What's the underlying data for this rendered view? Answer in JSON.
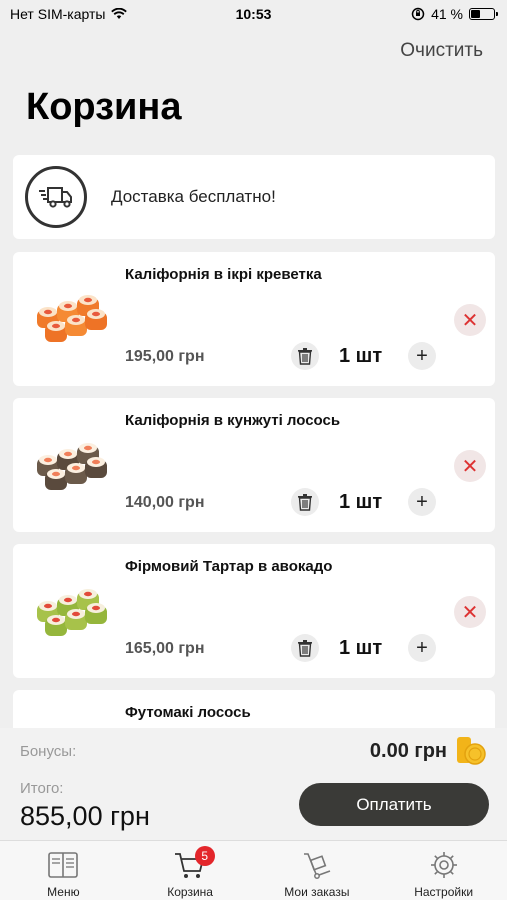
{
  "status_bar": {
    "carrier": "Нет SIM-карты",
    "time": "10:53",
    "battery_percent": "41 %"
  },
  "header": {
    "clear_label": "Очистить",
    "title": "Корзина"
  },
  "delivery": {
    "icon": "delivery-truck-icon",
    "text": "Доставка бесплатно!"
  },
  "cart_items": [
    {
      "name": "Каліфорнія в ікрі креветка",
      "price": "195,00 грн",
      "quantity": "1 шт",
      "image": "sushi-roll-orange"
    },
    {
      "name": "Каліфорнія в кунжуті лосось",
      "price": "140,00 грн",
      "quantity": "1 шт",
      "image": "sushi-roll-sesame"
    },
    {
      "name": "Фірмовий Тартар в авокадо",
      "price": "165,00 грн",
      "quantity": "1 шт",
      "image": "sushi-roll-avocado"
    },
    {
      "name": "Футомакі лосось"
    }
  ],
  "summary": {
    "bonus_label": "Бонусы:",
    "bonus_value": "0.00 грн",
    "total_label": "Итого:",
    "total_value": "855,00 грн",
    "pay_label": "Оплатить"
  },
  "tabbar": {
    "tabs": [
      {
        "label": "Меню",
        "icon": "menu-book-icon"
      },
      {
        "label": "Корзина",
        "icon": "cart-icon",
        "badge": "5"
      },
      {
        "label": "Мои заказы",
        "icon": "orders-cart-icon"
      },
      {
        "label": "Настройки",
        "icon": "gear-icon"
      }
    ]
  },
  "colors": {
    "background": "#efefef",
    "card": "#ffffff",
    "pay_button": "#3a3a37",
    "remove_x": "#dd3333",
    "badge": "#e3262b",
    "coin": "#f2b419"
  }
}
